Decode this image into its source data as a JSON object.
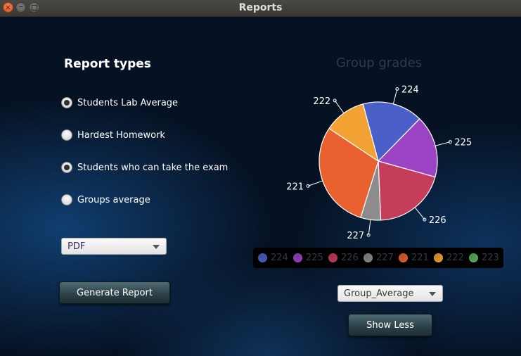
{
  "window": {
    "title": "Reports"
  },
  "report_types": {
    "heading": "Report types",
    "options": [
      {
        "label": "Students Lab Average",
        "checked": true
      },
      {
        "label": "Hardest Homework",
        "checked": false
      },
      {
        "label": "Students who can take the exam",
        "checked": true
      },
      {
        "label": "Groups average",
        "checked": false
      }
    ]
  },
  "format_select": {
    "value": "PDF"
  },
  "generate_button": {
    "label": "Generate Report"
  },
  "chart_select": {
    "value": "Group_Average"
  },
  "show_less_button": {
    "label": "Show Less"
  },
  "chart_data": {
    "type": "pie",
    "title": "Group grades",
    "slices": [
      {
        "label": "224",
        "value": 16.5,
        "color": "#4b5fc9"
      },
      {
        "label": "225",
        "value": 17.0,
        "color": "#9a44c4"
      },
      {
        "label": "226",
        "value": 20.0,
        "color": "#c53d5a"
      },
      {
        "label": "227",
        "value": 5.5,
        "color": "#8c8c8c"
      },
      {
        "label": "221",
        "value": 29.5,
        "color": "#e8612e"
      },
      {
        "label": "222",
        "value": 11.5,
        "color": "#f1a233"
      },
      {
        "label": "223",
        "value": 0.0,
        "color": "#5eb25e"
      }
    ],
    "legend": [
      "224",
      "225",
      "226",
      "227",
      "221",
      "222",
      "223"
    ],
    "legend_position": "bottom"
  }
}
